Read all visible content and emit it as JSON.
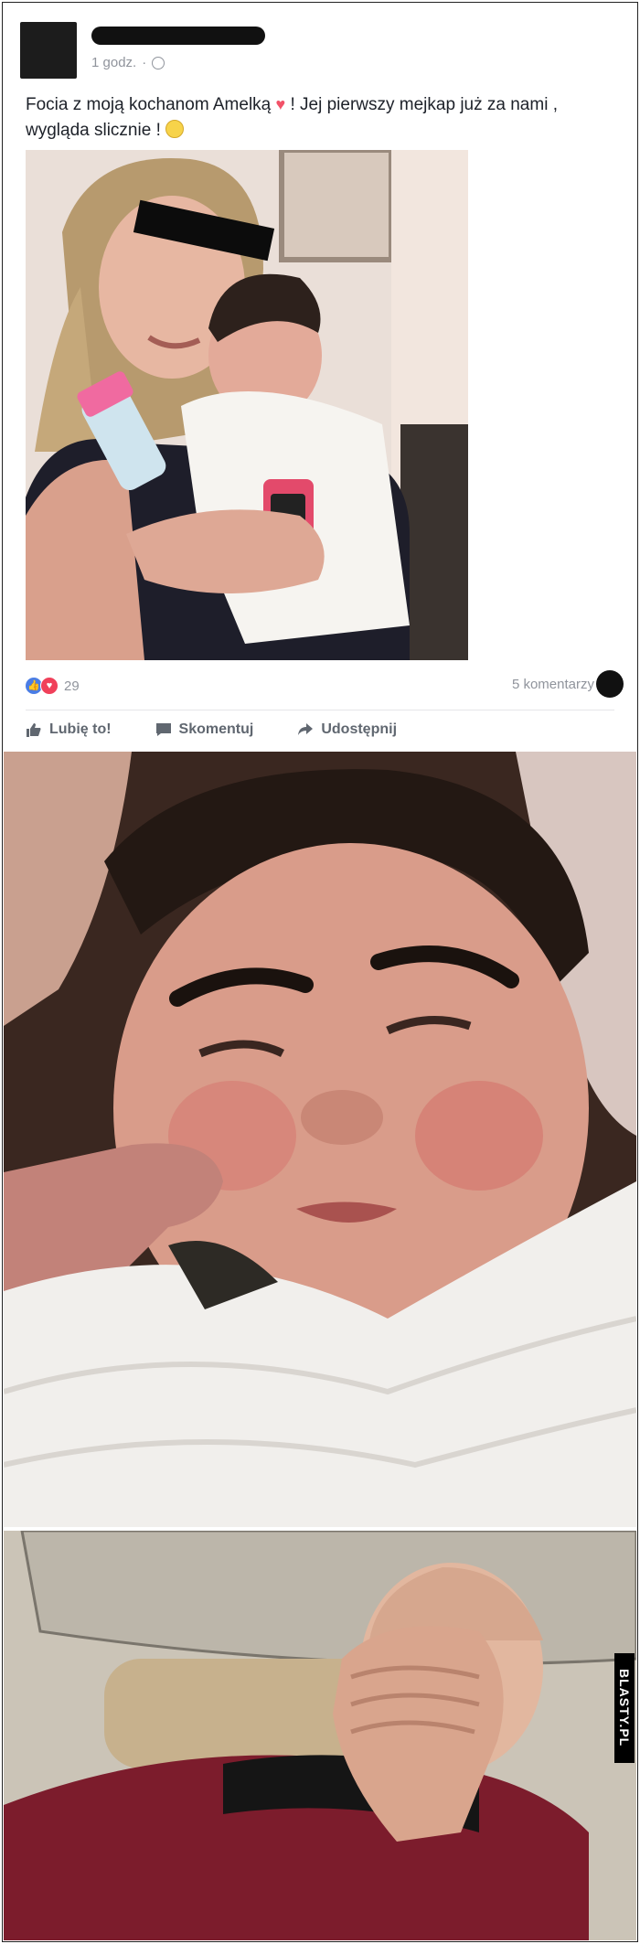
{
  "post": {
    "time": "1 godz.",
    "separator": "·",
    "text_part1": "Focia z moją kochanom Amelką",
    "text_part2": "! Jej pierwszy mejkap już za nami ,",
    "text_part3": "wygląda slicznie !",
    "reaction_count": "29",
    "comments": "5 komentarzy",
    "actions": {
      "like": "Lubię to!",
      "comment": "Skomentuj",
      "share": "Udostępnij"
    }
  },
  "watermark": "BLASTY.PL",
  "colors": {
    "fb_link": "#90949c",
    "text": "#1d2129",
    "like_blue": "#4a7de5",
    "love_red": "#f0405a"
  }
}
